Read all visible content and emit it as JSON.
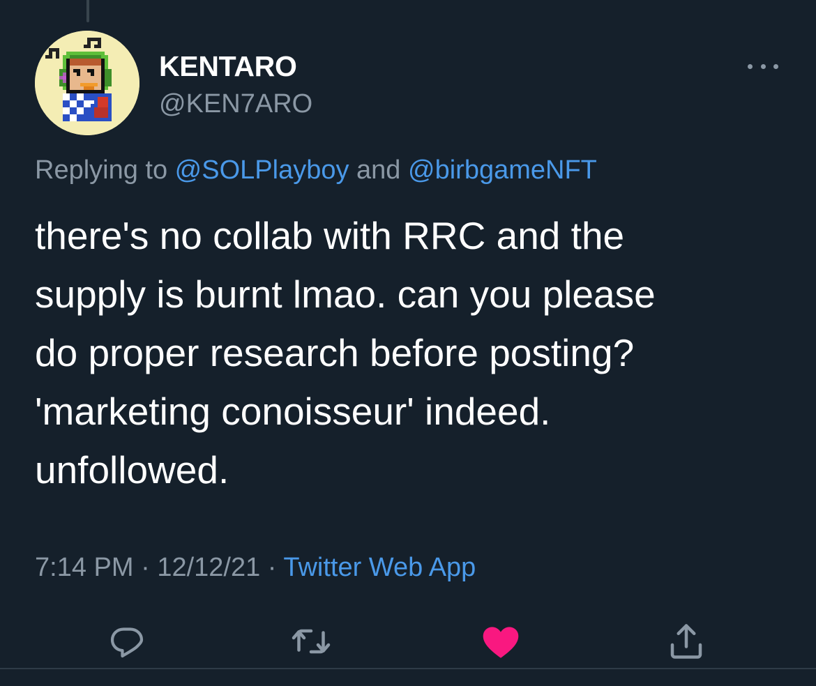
{
  "author": {
    "name": "KENTARO",
    "handle": "@KEN7ARO"
  },
  "reply": {
    "prefix": "Replying to ",
    "mention1": "@SOLPlayboy",
    "joiner": " and ",
    "mention2": "@birbgameNFT"
  },
  "tweet": {
    "lines": [
      "there's no collab with RRC and the",
      "supply is burnt lmao. can you please",
      "do proper research before posting?",
      "'marketing conoisseur' indeed.",
      "unfollowed."
    ]
  },
  "meta": {
    "time": "7:14 PM",
    "sep1": " · ",
    "date": "12/12/21",
    "sep2": " · ",
    "source": "Twitter Web App"
  },
  "actions": [
    {
      "icon": "reply-icon"
    },
    {
      "icon": "retweet-icon"
    },
    {
      "icon": "like-icon",
      "active": true
    },
    {
      "icon": "share-icon"
    }
  ],
  "colors": {
    "background": "#15202b",
    "text_secondary": "#8b98a5",
    "link": "#4a99e9",
    "like": "#f91880"
  }
}
